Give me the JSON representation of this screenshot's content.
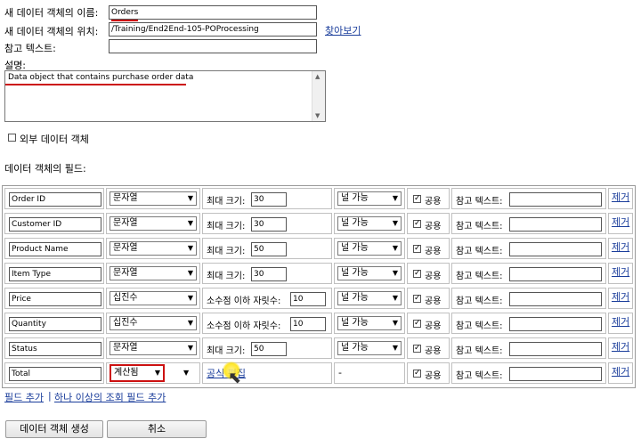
{
  "form": {
    "name_label": "새 데이터 객체의 이름:",
    "name_value": "Orders",
    "location_label": "새 데이터 객체의 위치:",
    "location_value": "/Training/End2End-105-POProcessing",
    "browse_link": "찾아보기",
    "ref_label": "참고 텍스트:",
    "ref_value": "",
    "desc_label": "설명:",
    "desc_value": "Data object that contains purchase order data",
    "external_label": "외부 데이터 객체",
    "fields_heading": "데이터 객체의 필드:"
  },
  "fields": [
    {
      "name": "Order ID",
      "type": "문자열",
      "size_label": "최대 크기:",
      "size_value": "30",
      "null_value": "널 가능",
      "public_label": "공용",
      "public_checked": true,
      "ref_label": "참고 텍스트:",
      "ref_value": "",
      "delete": "제거"
    },
    {
      "name": "Customer ID",
      "type": "문자열",
      "size_label": "최대 크기:",
      "size_value": "30",
      "null_value": "널 가능",
      "public_label": "공용",
      "public_checked": true,
      "ref_label": "참고 텍스트:",
      "ref_value": "",
      "delete": "제거"
    },
    {
      "name": "Product Name",
      "type": "문자열",
      "size_label": "최대 크기:",
      "size_value": "50",
      "null_value": "널 가능",
      "public_label": "공용",
      "public_checked": true,
      "ref_label": "참고 텍스트:",
      "ref_value": "",
      "delete": "제거"
    },
    {
      "name": "Item Type",
      "type": "문자열",
      "size_label": "최대 크기:",
      "size_value": "30",
      "null_value": "널 가능",
      "public_label": "공용",
      "public_checked": true,
      "ref_label": "참고 텍스트:",
      "ref_value": "",
      "delete": "제거"
    },
    {
      "name": "Price",
      "type": "십진수",
      "size_label": "소수점 이하 자릿수:",
      "size_value": "10",
      "null_value": "널 가능",
      "public_label": "공용",
      "public_checked": true,
      "ref_label": "참고 텍스트:",
      "ref_value": "",
      "delete": "제거"
    },
    {
      "name": "Quantity",
      "type": "십진수",
      "size_label": "소수점 이하 자릿수:",
      "size_value": "10",
      "null_value": "널 가능",
      "public_label": "공용",
      "public_checked": true,
      "ref_label": "참고 텍스트:",
      "ref_value": "",
      "delete": "제거"
    },
    {
      "name": "Status",
      "type": "문자열",
      "size_label": "최대 크기:",
      "size_value": "50",
      "null_value": "널 가능",
      "public_label": "공용",
      "public_checked": true,
      "ref_label": "참고 텍스트:",
      "ref_value": "",
      "delete": "제거"
    }
  ],
  "computed_field": {
    "name": "Total",
    "type": "계산됨",
    "formula_link": "공식 편집",
    "null_value": "-",
    "public_label": "공용",
    "public_checked": true,
    "ref_label": "참고 텍스트:",
    "ref_value": "",
    "delete": "제거"
  },
  "links": {
    "add_field": "필드 추가",
    "separator": "|",
    "add_lookup": "하나 이상의 조회 필드 추가"
  },
  "buttons": {
    "create": "데이터 객체 생성",
    "cancel": "취소"
  },
  "colors": {
    "highlight_red": "#cc1111",
    "link_blue": "#1a3d9b"
  }
}
